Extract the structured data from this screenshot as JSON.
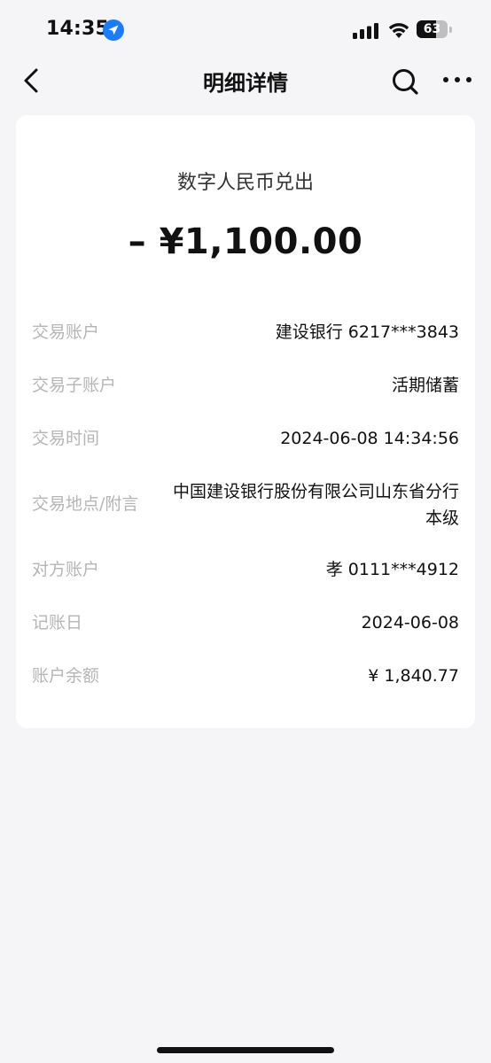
{
  "status_bar": {
    "time": "14:35",
    "battery_level": "63",
    "battery_fraction": 0.63,
    "icons": [
      "location-arrow-icon",
      "signal-icon",
      "wifi-icon",
      "battery-icon"
    ],
    "location_color": "#1a7cff"
  },
  "nav": {
    "title": "明细详情",
    "icons": [
      "back-icon",
      "search-icon",
      "more-icon"
    ]
  },
  "transaction": {
    "type": "数字人民币兑出",
    "amount": "– ¥1,100.00"
  },
  "details": {
    "account_label": "交易账户",
    "account_value": "建设银行 6217***3843",
    "subaccount_label": "交易子账户",
    "subaccount_value": "活期储蓄",
    "time_label": "交易时间",
    "time_value": "2024-06-08 14:34:56",
    "location_label": "交易地点/附言",
    "location_value": "中国建设银行股份有限公司山东省分行本级",
    "counter_label": "对方账户",
    "counter_value": "孝 0111***4912",
    "date_label": "记账日",
    "date_value": "2024-06-08",
    "balance_label": "账户余额",
    "balance_value": "¥ 1,840.77"
  }
}
